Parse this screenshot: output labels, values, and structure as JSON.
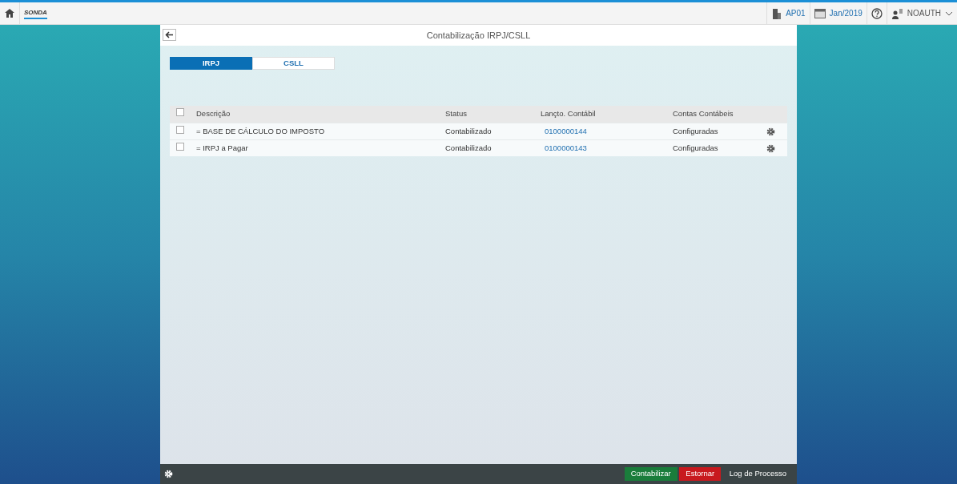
{
  "shell": {
    "logo": "SONDA",
    "company": "AP01",
    "period": "Jan/2019",
    "user": "NOAUTH"
  },
  "page": {
    "title": "Contabilização IRPJ/CSLL"
  },
  "tabs": [
    {
      "label": "IRPJ",
      "selected": true
    },
    {
      "label": "CSLL",
      "selected": false
    }
  ],
  "table": {
    "columns": [
      "Descrição",
      "Status",
      "Lançto. Contábil",
      "Contas Contábeis"
    ],
    "all_checked": false,
    "rows": [
      {
        "checked": false,
        "description": "= BASE DE CÁLCULO DO IMPOSTO",
        "status": "Contabilizado",
        "document": "0100000144",
        "accounts": "Configuradas"
      },
      {
        "checked": false,
        "description": "= IRPJ a Pagar",
        "status": "Contabilizado",
        "document": "0100000143",
        "accounts": "Configuradas"
      }
    ]
  },
  "footer": {
    "buttons": [
      {
        "label": "Contabilizar",
        "kind": "accept"
      },
      {
        "label": "Estornar",
        "kind": "reject"
      },
      {
        "label": "Log de Processo",
        "kind": "plain"
      }
    ]
  }
}
